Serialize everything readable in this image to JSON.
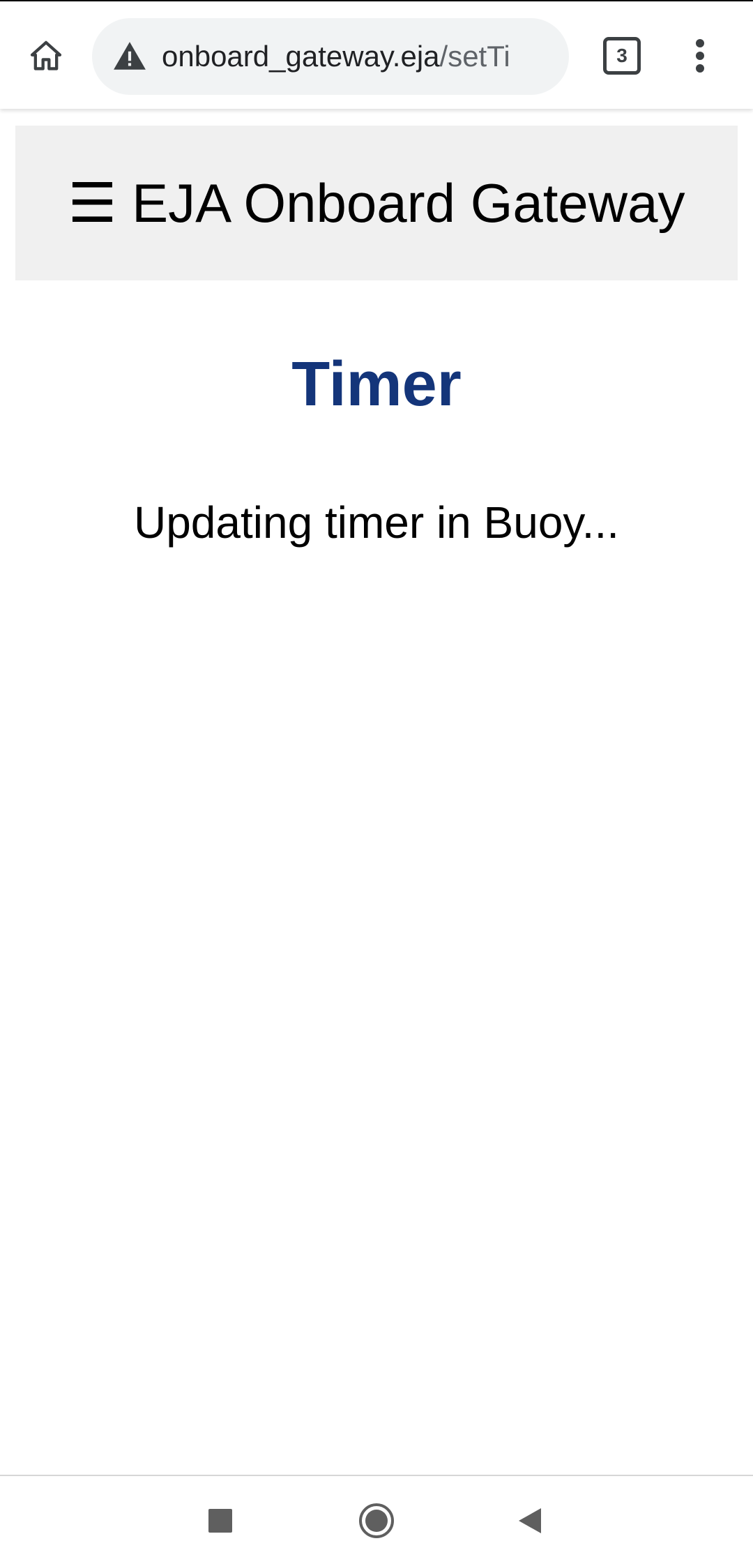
{
  "browser": {
    "url_host": "onboard_gateway.eja",
    "url_path": "/setTi",
    "tab_count": "3",
    "icons": {
      "home": "home-icon",
      "security": "warning-triangle-icon",
      "tabs": "tab-switcher-icon",
      "menu": "more-vert-icon"
    }
  },
  "page": {
    "header_title": "☰ EJA Onboard Gateway",
    "heading": "Timer",
    "status": "Updating timer in Buoy...",
    "colors": {
      "heading": "#14357a",
      "header_bg": "#f0f0f0"
    }
  },
  "system_nav": {
    "icons": {
      "recent": "recent-apps-icon",
      "home": "home-circle-icon",
      "back": "back-triangle-icon"
    }
  }
}
